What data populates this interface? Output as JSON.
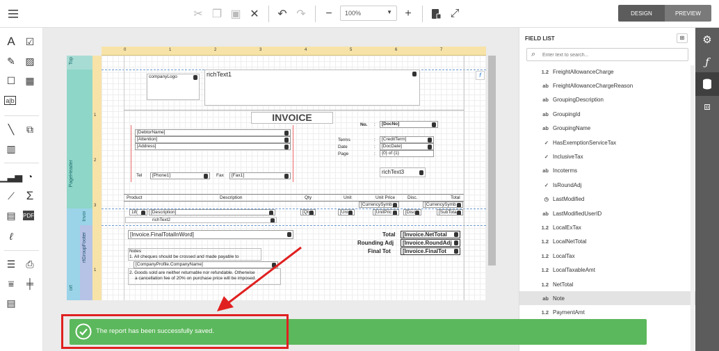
{
  "toolbar": {
    "zoom_value": "100%",
    "design_label": "DESIGN",
    "preview_label": "PREVIEW"
  },
  "field_list": {
    "title": "FIELD LIST",
    "search_placeholder": "Enter text to search...",
    "items": [
      {
        "type": "1.2",
        "name": "FreightAllowanceCharge"
      },
      {
        "type": "ab",
        "name": "FreightAllowanceChargeReason"
      },
      {
        "type": "ab",
        "name": "GroupingDescription"
      },
      {
        "type": "ab",
        "name": "GroupingId"
      },
      {
        "type": "ab",
        "name": "GroupingName"
      },
      {
        "type": "✓",
        "name": "HasExemptionServiceTax"
      },
      {
        "type": "✓",
        "name": "InclusiveTax"
      },
      {
        "type": "ab",
        "name": "Incoterms"
      },
      {
        "type": "✓",
        "name": "IsRoundAdj"
      },
      {
        "type": "◷",
        "name": "LastModified"
      },
      {
        "type": "ab",
        "name": "LastModifiedUserID"
      },
      {
        "type": "1.2",
        "name": "LocalExTax"
      },
      {
        "type": "1.2",
        "name": "LocalNetTotal"
      },
      {
        "type": "1.2",
        "name": "LocalTax"
      },
      {
        "type": "1.2",
        "name": "LocalTaxableAmt"
      },
      {
        "type": "1.2",
        "name": "NetTotal"
      },
      {
        "type": "ab",
        "name": "Note"
      },
      {
        "type": "1.2",
        "name": "PaymentAmt"
      }
    ],
    "selected_index": 16
  },
  "bands": {
    "top": "Top",
    "page_header": "PageHeader",
    "invoice": "Invoi",
    "report": "ort",
    "group_footer": "rtGroupFooter"
  },
  "report": {
    "company_logo": "companyLogo",
    "rich_text_1": "richText1",
    "title": "INVOICE",
    "no_label": "No.",
    "colon": ":",
    "doc_no": "[DocNo]",
    "debtor_name": "[DebtorName]",
    "attention": "[Attention]",
    "address": "[Address]",
    "terms_label": "Terms",
    "date_label": "Date",
    "page_label": "Page",
    "credit_term": "[CreditTerm]",
    "doc_date": "[DocDate]",
    "page_of": "{0} of {1}",
    "rich_text_3": "richText3",
    "tel_label": "Tel",
    "phone": "[Phone1]",
    "fax_label": "Fax",
    "fax": "[Fax1]",
    "col_product": "Product",
    "col_description": "Description",
    "col_qty": "Qty",
    "col_unit": "Unit",
    "col_unit_price": "Unit Price",
    "col_disc": "Disc.",
    "col_total": "Total",
    "currency_symbol_1": "[CurrencySymb",
    "currency_symbol_2": "[CurrencySymb",
    "row_item": "1if(",
    "row_description": "[Description]",
    "row_qty": "[Qty",
    "row_unit": "[Uni",
    "row_unit_price": "[UnitPric",
    "row_disc": "[Disc",
    "row_subtotal": "[SubTota",
    "rich_text_2": "richText2",
    "total_in_word": "[Invoice.FinalTotalInWord]",
    "total_label": "Total",
    "rounding_label": "Rounding Adj",
    "final_total_label": "Final Tot",
    "net_total": "[Invoice.NetTotal",
    "rounding_adj": "[Invoice.RoundAdj",
    "final_total": "[Invoice.FinalTot",
    "notes_title": "Notes",
    "note_1": "1. All cheques should be crossed and made payable to",
    "company_name": "[CompanyProfile.CompanyName]",
    "note_2a": "2. Goods sold are neither returnable nor refundable. Otherwise",
    "note_2b": "a cancellation fee of 20% on purchase price will be imposed.",
    "ruler_top": [
      "0",
      "1",
      "2",
      "3",
      "4",
      "5",
      "6",
      "7"
    ],
    "ruler_left": [
      "1",
      "2",
      "3",
      "1"
    ]
  },
  "toast": {
    "message": "The report has been successfully saved."
  },
  "colors": {
    "accent_dark": "#5c5c5c",
    "toast_green": "#5cb85c",
    "highlight_red": "#e02020"
  }
}
